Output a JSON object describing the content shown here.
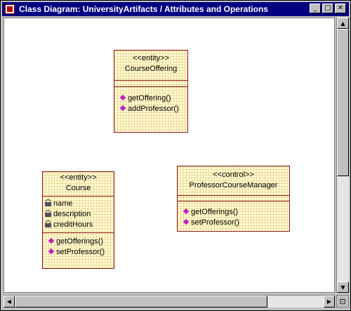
{
  "window": {
    "title": "Class Diagram: UniversityArtifacts / Attributes and Operations",
    "controls": {
      "minimize": "_",
      "maximize": "□",
      "close": "✕"
    }
  },
  "diagram": {
    "course_offering": {
      "stereotype": "<<entity>>",
      "name": "CourseOffering",
      "attributes": [],
      "operations": [
        "getOffering()",
        "addProfessor()"
      ]
    },
    "course": {
      "stereotype": "<<entity>>",
      "name": "Course",
      "attributes": [
        "name",
        "description",
        "creditHours"
      ],
      "operations": [
        "getOfferings()",
        "setProfessor()"
      ]
    },
    "professor_course_manager": {
      "stereotype": "<<control>>",
      "name": "ProfessorCourseManager",
      "attributes": [],
      "operations": [
        "getOfferings()",
        "setProfessor()"
      ]
    }
  },
  "icons": {
    "operation": "operation-icon",
    "attribute": "attribute-lock-icon"
  },
  "colors": {
    "titlebar": "#000080",
    "class_fill": "#ffffd8",
    "class_border": "#8b1a1a",
    "operation_icon": "#c020c0"
  }
}
